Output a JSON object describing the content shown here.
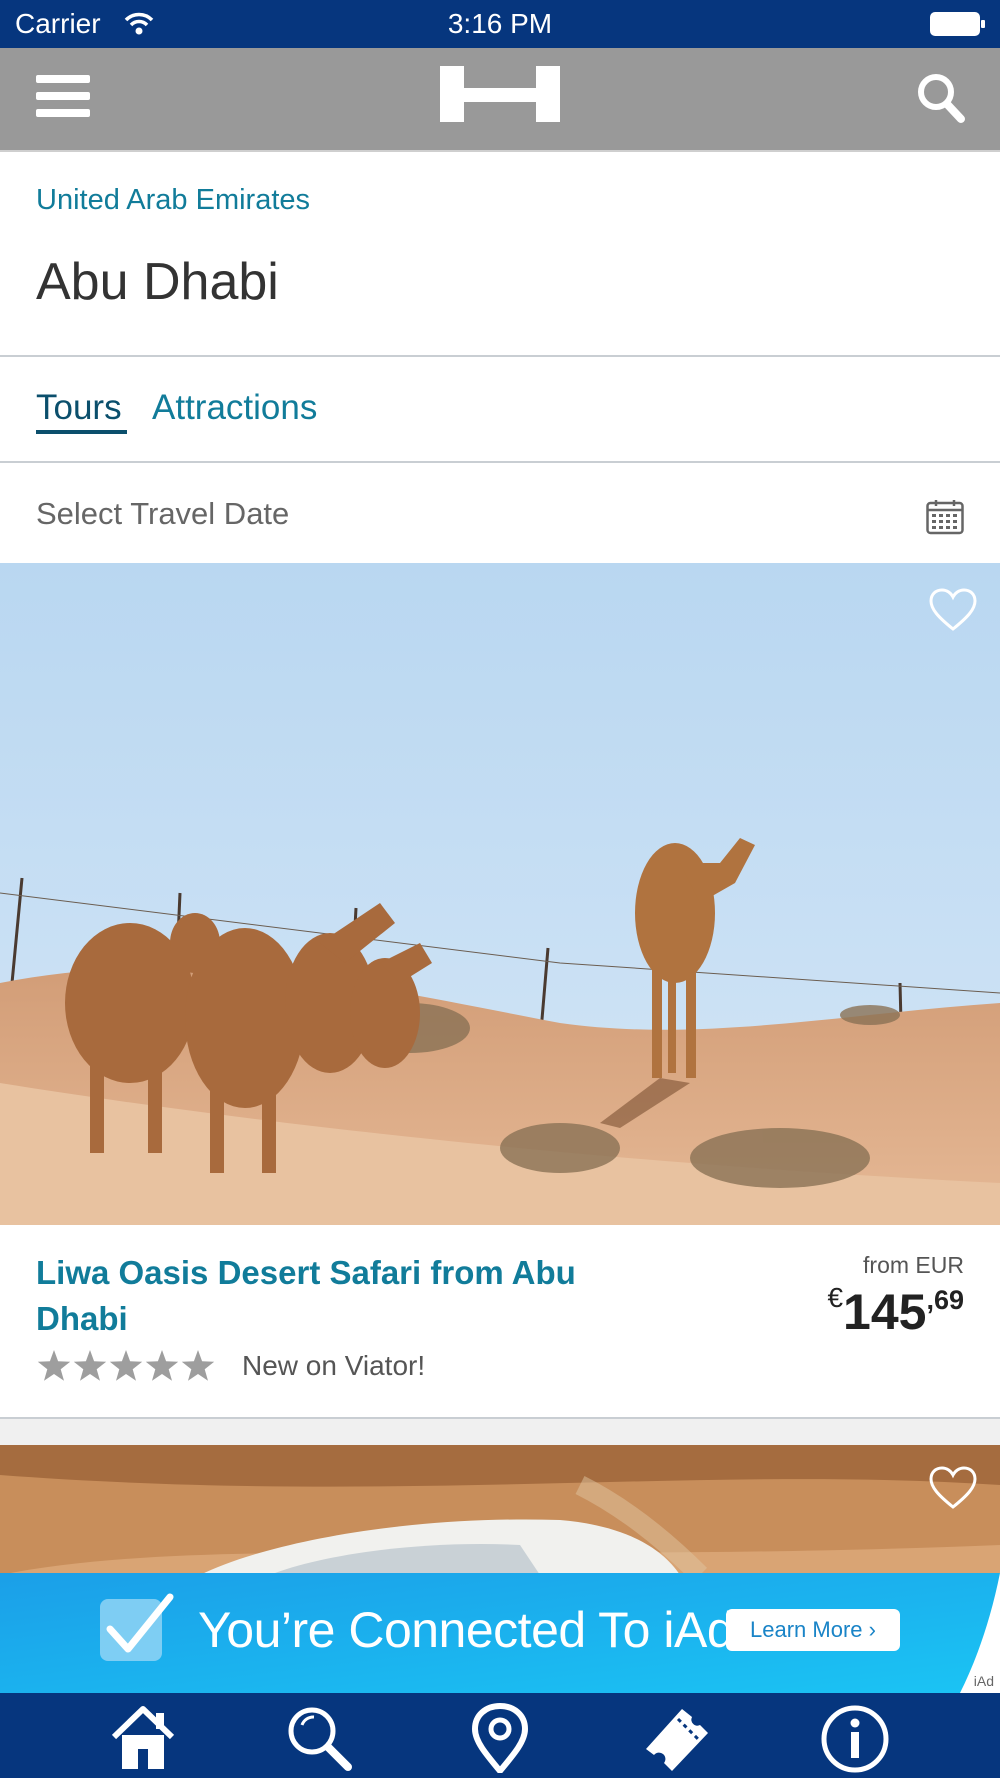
{
  "status_bar": {
    "carrier": "Carrier",
    "time": "3:16 PM"
  },
  "header": {
    "country": "United Arab Emirates",
    "city": "Abu Dhabi"
  },
  "tabs": [
    {
      "label": "Tours",
      "active": true
    },
    {
      "label": "Attractions",
      "active": false
    }
  ],
  "date_picker": {
    "label": "Select Travel Date"
  },
  "card": {
    "title": "Liwa Oasis Desert Safari from Abu Dhabi",
    "price_from": "from EUR",
    "price_currency": "€",
    "price_whole": "145",
    "price_cents": ",69",
    "rating": 5,
    "review_note": "New on Viator!"
  },
  "ad": {
    "text": "You’re Connected To iAd",
    "button": "Learn More ›",
    "mark": "iAd"
  },
  "icons": {
    "nav": [
      "menu-icon",
      "logo-icon",
      "search-icon"
    ],
    "tab_bar": [
      "home-icon",
      "search-icon",
      "location-pin-icon",
      "ticket-icon",
      "info-icon"
    ]
  },
  "colors": {
    "status_bar": "#06367e",
    "nav_bar": "#999999",
    "link": "#117c9a",
    "ad_blue": "#1aa8ec"
  }
}
